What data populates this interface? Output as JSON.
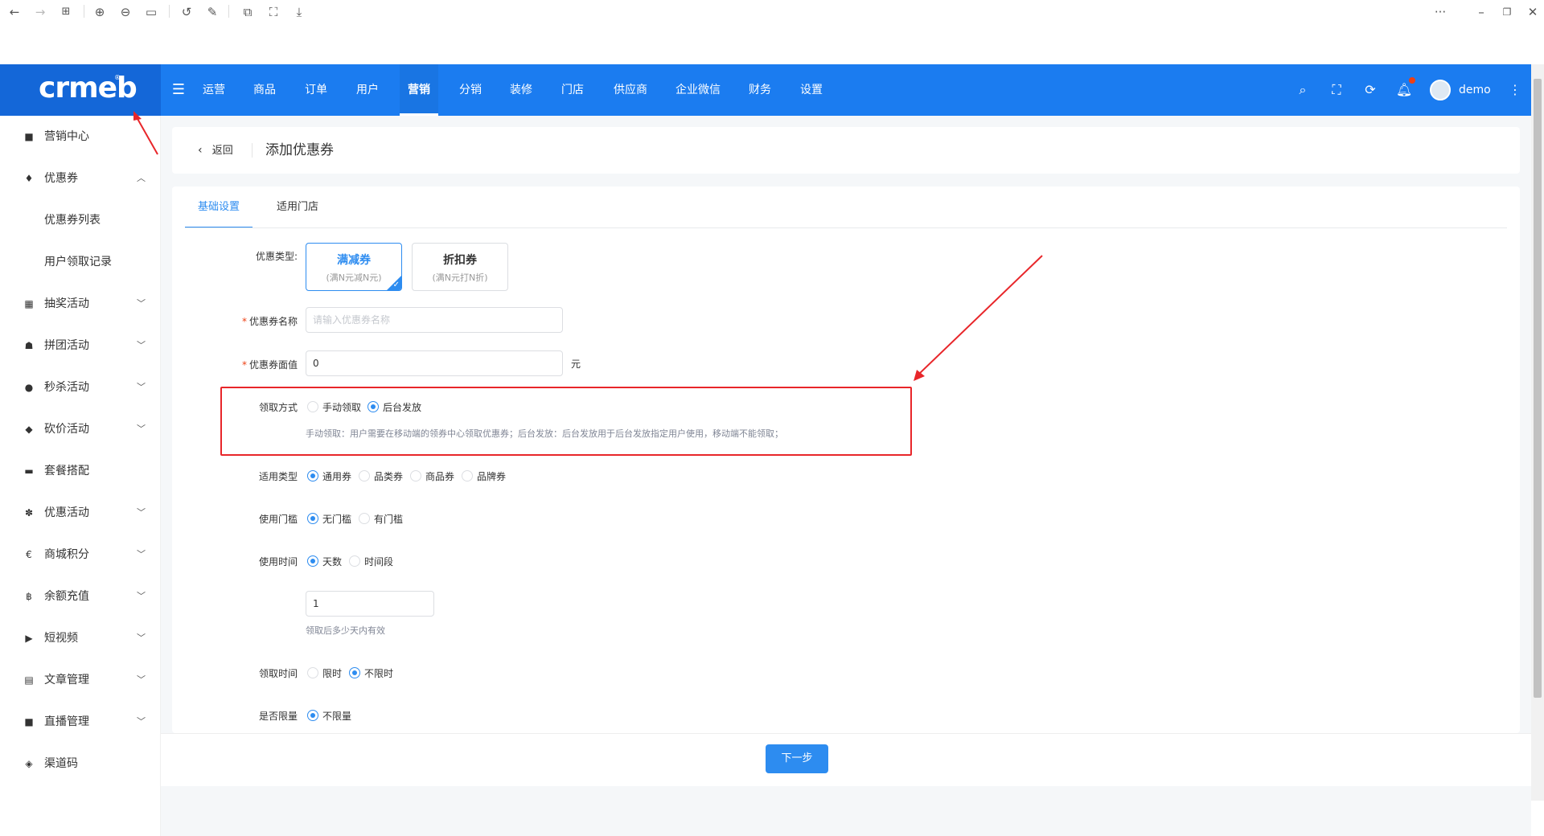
{
  "viewer": {
    "back_icon": "arrow-left-icon",
    "forward_icon": "arrow-right-icon",
    "more_label": "···"
  },
  "header": {
    "logo": "crmeb",
    "nav": [
      "运营",
      "商品",
      "订单",
      "用户",
      "营销",
      "分销",
      "装修",
      "门店",
      "供应商",
      "企业微信",
      "财务",
      "设置"
    ],
    "active_nav": "营销",
    "username": "demo"
  },
  "sidebar": {
    "items": [
      {
        "label": "营销中心",
        "icon": "square-icon"
      },
      {
        "label": "优惠券",
        "icon": "coupon-icon",
        "expanded": true
      },
      {
        "label": "优惠券列表",
        "sub": true
      },
      {
        "label": "用户领取记录",
        "sub": true
      },
      {
        "label": "抽奖活动",
        "icon": "grid-icon",
        "chevron": true
      },
      {
        "label": "拼团活动",
        "icon": "group-icon",
        "chevron": true
      },
      {
        "label": "秒杀活动",
        "icon": "clock-icon",
        "chevron": true
      },
      {
        "label": "砍价活动",
        "icon": "tag-icon",
        "chevron": true
      },
      {
        "label": "套餐搭配",
        "icon": "package-icon"
      },
      {
        "label": "优惠活动",
        "icon": "gift-icon",
        "chevron": true
      },
      {
        "label": "商城积分",
        "icon": "euro-icon",
        "chevron": true
      },
      {
        "label": "余额充值",
        "icon": "bitcoin-icon",
        "chevron": true
      },
      {
        "label": "短视频",
        "icon": "video-icon",
        "chevron": true
      },
      {
        "label": "文章管理",
        "icon": "article-icon",
        "chevron": true
      },
      {
        "label": "直播管理",
        "icon": "camera-icon",
        "chevron": true
      },
      {
        "label": "渠道码",
        "icon": "cube-icon"
      }
    ]
  },
  "page": {
    "back_label": "返回",
    "title": "添加优惠券"
  },
  "tabs": [
    "基础设置",
    "适用门店"
  ],
  "form": {
    "coupon_type_label": "优惠类型:",
    "type_cards": [
      {
        "title": "满减券",
        "sub": "(满N元减N元)",
        "selected": true
      },
      {
        "title": "折扣券",
        "sub": "(满N元打N折)",
        "selected": false
      }
    ],
    "name_label": "优惠券名称",
    "name_placeholder": "请输入优惠券名称",
    "value_label": "优惠券面值",
    "value_value": "0",
    "value_unit": "元",
    "receive_method_label": "领取方式",
    "receive_options": [
      "手动领取",
      "后台发放"
    ],
    "receive_selected": "后台发放",
    "receive_hint": "手动领取：用户需要在移动端的领券中心领取优惠券；后台发放：后台发放用于后台发放指定用户使用，移动端不能领取；",
    "apply_type_label": "适用类型",
    "apply_options": [
      "通用券",
      "品类券",
      "商品券",
      "品牌券"
    ],
    "apply_selected": "通用券",
    "threshold_label": "使用门槛",
    "threshold_options": [
      "无门槛",
      "有门槛"
    ],
    "threshold_selected": "无门槛",
    "use_time_label": "使用时间",
    "use_time_options": [
      "天数",
      "时间段"
    ],
    "use_time_selected": "天数",
    "days_value": "1",
    "days_hint": "领取后多少天内有效",
    "receive_time_label": "领取时间",
    "receive_time_options": [
      "限时",
      "不限时"
    ],
    "receive_time_selected": "不限时",
    "limit_label": "是否限量",
    "limit_options": [
      "不限量"
    ],
    "limit_selected": "不限量"
  },
  "footer": {
    "next_label": "下一步"
  },
  "colors": {
    "header_blue": "#1b7cf0",
    "logo_blue": "#1467d8",
    "primary": "#2d8cf0",
    "annotation_red": "#e8262a"
  }
}
